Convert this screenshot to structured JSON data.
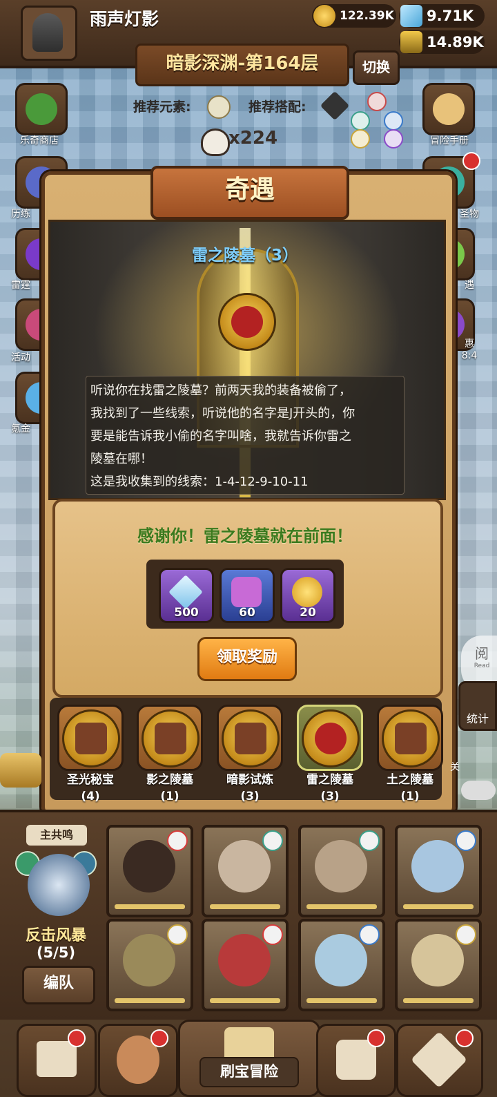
{
  "player": {
    "name": "雨声灯影"
  },
  "resources": {
    "gold": "122.39K",
    "diamond": "9.71K",
    "potion": "14.89K"
  },
  "stage": {
    "title": "暗影深渊-第164层",
    "switch_label": "切换",
    "recommend_element_label": "推荐元素:",
    "recommend_combo_label": "推荐搭配:",
    "skull_count": "x224"
  },
  "left_menu": [
    {
      "label": "乐奇商店",
      "icon": "clover-icon"
    },
    {
      "label": "历练",
      "icon": "jar-icon"
    },
    {
      "label": "雷霆",
      "icon": "orb-icon"
    },
    {
      "label": "活动",
      "icon": "gift-icon"
    },
    {
      "label": "氪金",
      "icon": "diamond-icon"
    }
  ],
  "right_menu": [
    {
      "label": "冒险手册",
      "icon": "scroll-icon"
    },
    {
      "label": "圣物",
      "icon": "chest-icon"
    },
    {
      "label": "遇",
      "icon": "note-icon"
    },
    {
      "label": "惠",
      "icon": "bag-icon",
      "extra": "8:4"
    }
  ],
  "modal": {
    "title": "奇遇",
    "event_title": "雷之陵墓（3）",
    "story_lines": [
      "听说你在找雷之陵墓？前两天我的装备被偷了，",
      "我找到了一些线索，听说他的名字是J开头的，你",
      "要是能告诉我小偷的名字叫啥，我就告诉你雷之",
      "陵墓在哪！",
      "这是我收集到的线索：1-4-12-9-10-11"
    ],
    "thanks": "感谢你！雷之陵墓就在前面！",
    "rewards": [
      {
        "icon": "diamond-icon",
        "qty": "500"
      },
      {
        "icon": "puzzle-icon",
        "qty": "60"
      },
      {
        "icon": "coin-icon",
        "qty": "20"
      }
    ],
    "claim_label": "领取奖励",
    "events": [
      {
        "name": "圣光秘宝",
        "count": "(4)",
        "selected": false
      },
      {
        "name": "影之陵墓",
        "count": "(1)",
        "selected": false
      },
      {
        "name": "暗影试炼",
        "count": "(3)",
        "selected": false
      },
      {
        "name": "雷之陵墓",
        "count": "(3)",
        "selected": true
      },
      {
        "name": "土之陵墓",
        "count": "(1)",
        "selected": false
      }
    ]
  },
  "side_right": {
    "read_label": "阅",
    "read_sub": "Read",
    "stats_label": "统计",
    "partial_label": "关"
  },
  "team": {
    "master_label": "主共鸣",
    "combo_name": "反击风暴",
    "combo_count": "(5/5)",
    "team_button": "编队"
  },
  "bottom_nav": {
    "center_label": "刷宝冒险"
  },
  "colors": {
    "accent_gold": "#ffe6a0",
    "thanks_green": "#3a7a1e",
    "event_blue": "#7fd0ff",
    "claim_orange": "#e07b12",
    "badge_red": "#d8312f"
  }
}
